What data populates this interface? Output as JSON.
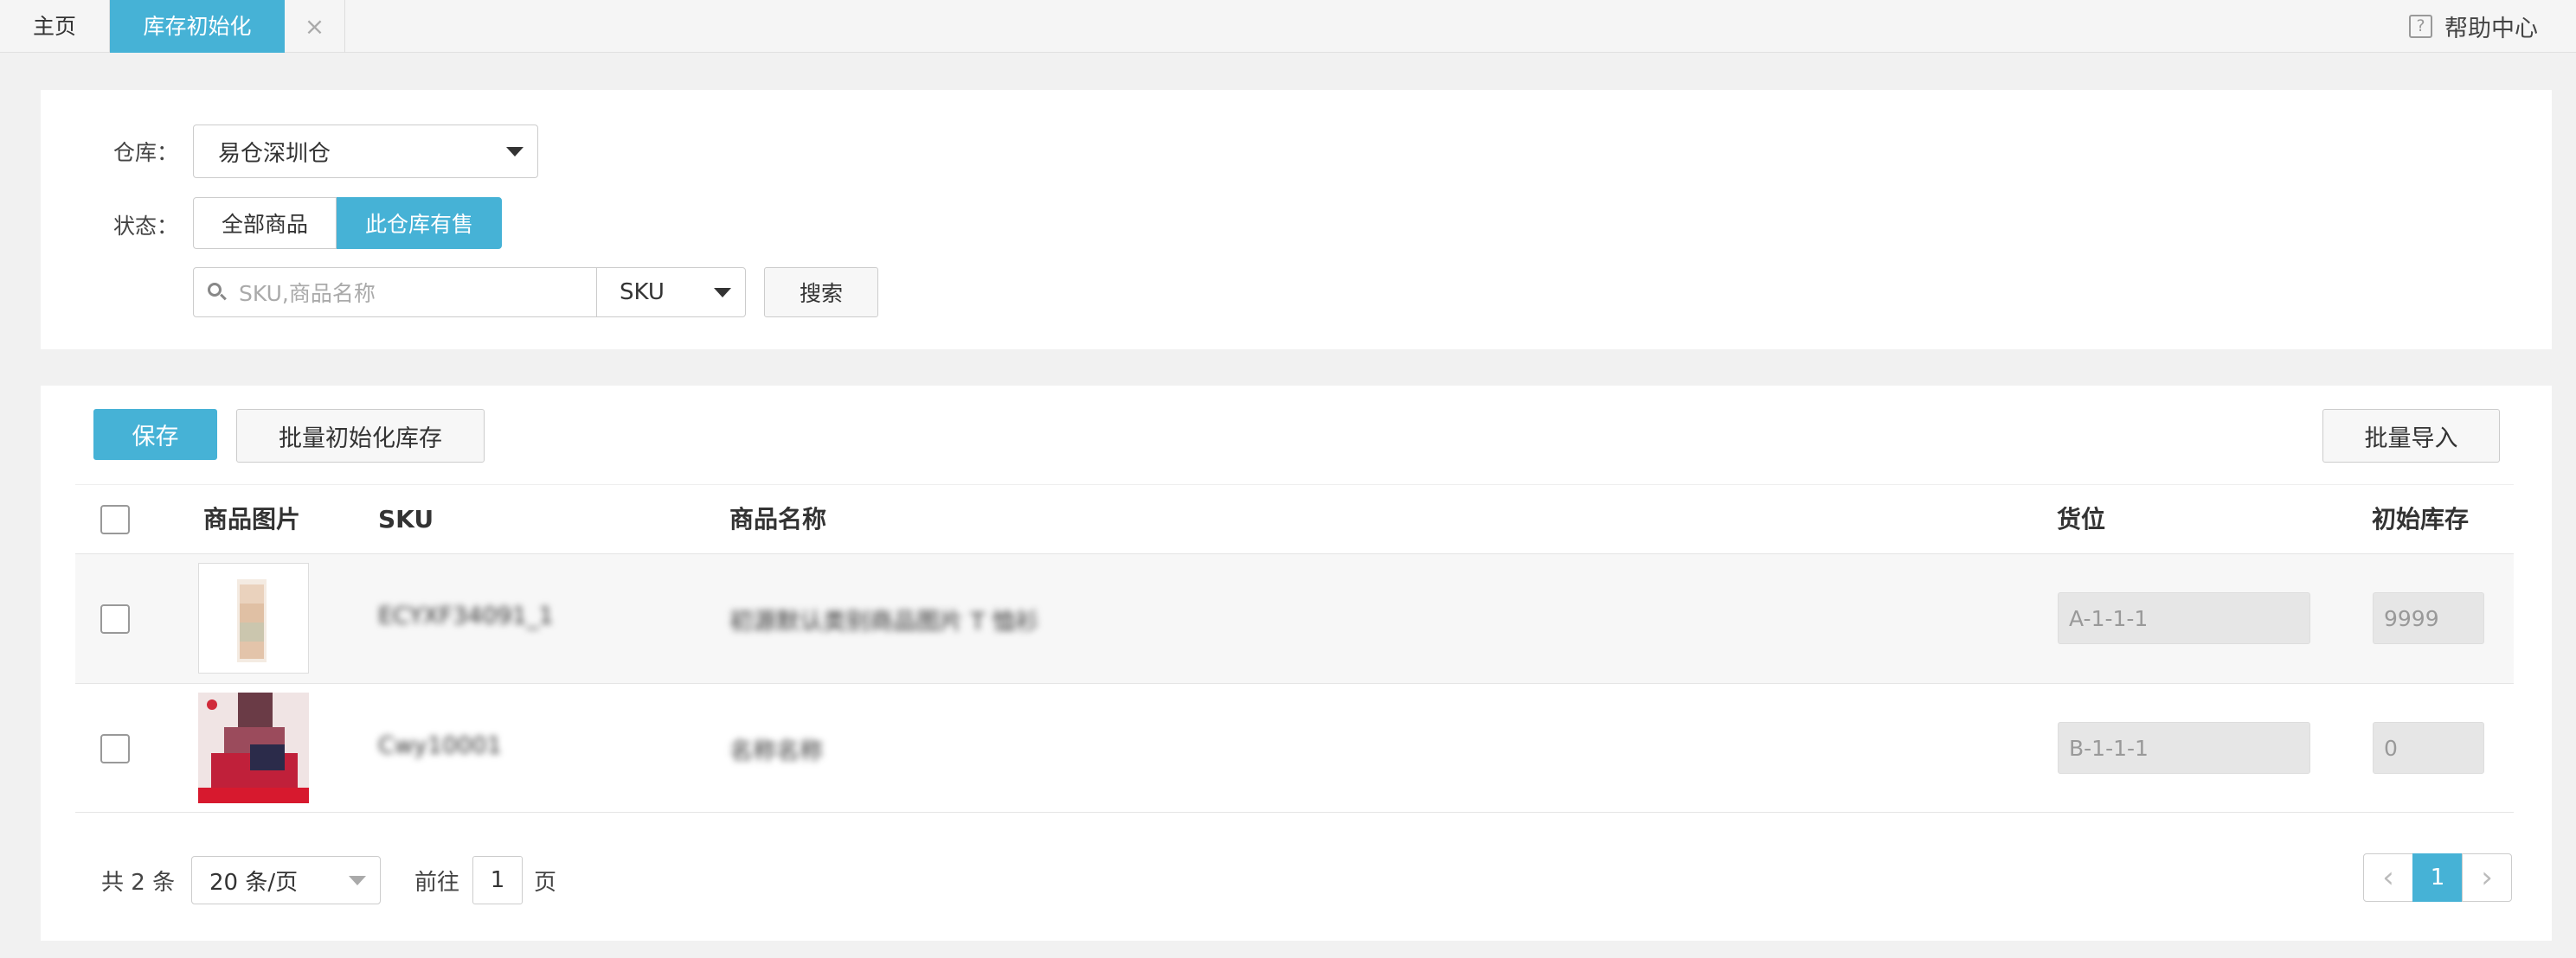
{
  "tabs": {
    "home": "主页",
    "active": "库存初始化",
    "close": "×"
  },
  "help": {
    "icon": "?",
    "label": "帮助中心"
  },
  "filters": {
    "warehouse_label": "仓库：",
    "warehouse_value": "易仓深圳仓",
    "status_label": "状态：",
    "status_all": "全部商品",
    "status_selling": "此仓库有售",
    "search_placeholder": "SKU,商品名称",
    "search_field": "SKU",
    "search_button": "搜索"
  },
  "toolbar": {
    "save": "保存",
    "batch_init": "批量初始化库存",
    "batch_import": "批量导入"
  },
  "table": {
    "headers": {
      "image": "商品图片",
      "sku": "SKU",
      "name": "商品名称",
      "location": "货位",
      "stock": "初始库存"
    },
    "rows": [
      {
        "sku": "ECYXF34091_1",
        "name": "初源默认类别商品图片 T 恤衫",
        "location": "A-1-1-1",
        "stock": "9999"
      },
      {
        "sku": "Cwy10001",
        "name": "名称名称",
        "location": "B-1-1-1",
        "stock": "0"
      }
    ]
  },
  "footer": {
    "total": "共 2 条",
    "page_size": "20 条/页",
    "goto_prefix": "前往",
    "goto_page": "1",
    "goto_suffix": "页",
    "current_page": "1",
    "prev": "‹",
    "next": "›"
  },
  "colors": {
    "accent": "#46b2d6"
  }
}
